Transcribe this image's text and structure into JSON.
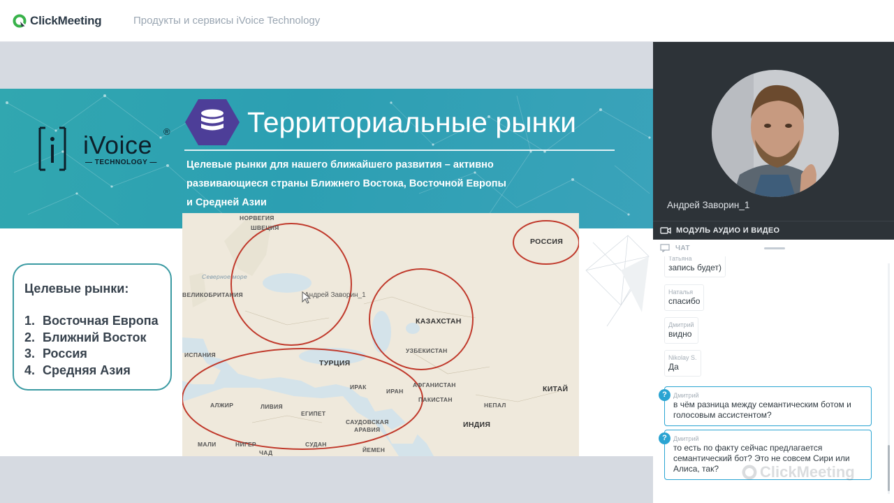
{
  "app": {
    "brand": "ClickMeeting",
    "meeting_title": "Продукты и сервисы iVoice Technology"
  },
  "slide": {
    "company_name": "iVoice",
    "company_reg": "®",
    "company_sub": "— TECHNOLOGY —",
    "title": "Территориальные рынки",
    "subtitle_lines": [
      "Целевые рынки для нашего ближайшего развития – активно",
      "развивающиеся страны Ближнего Востока, Восточной Европы",
      "и Средней Азии"
    ],
    "markets_title": "Целевые рынки:",
    "markets": [
      {
        "num": "1.",
        "label": "Восточная Европа"
      },
      {
        "num": "2.",
        "label": "Ближний Восток"
      },
      {
        "num": "3.",
        "label": "Россия"
      },
      {
        "num": "4.",
        "label": "Средняя Азия"
      }
    ],
    "map": {
      "russia": "РОССИЯ",
      "kazakhstan": "КАЗАХСТАН",
      "uzbekistan": "УЗБЕКИСТАН",
      "norway": "НОРВЕГИЯ",
      "sweden": "ШВЕЦИЯ",
      "sea": "Северное море",
      "britain": "ВЕЛИКОБРИТАНИЯ",
      "spain": "ИСПАНИЯ",
      "turkey": "ТУРЦИЯ",
      "iraq": "ИРАК",
      "iran": "ИРАН",
      "afghanistan": "АФГАНИСТАН",
      "pakistan": "ПАКИСТАН",
      "china": "КИТАЙ",
      "nepal": "НЕПАЛ",
      "india": "ИНДИЯ",
      "algeria": "АЛЖИР",
      "libya": "ЛИВИЯ",
      "egypt": "ЕГИПЕТ",
      "saudi1": "САУДОВСКАЯ",
      "saudi2": "АРАВИЯ",
      "mali": "МАЛИ",
      "niger": "НИГЕР",
      "sudan": "СУДАН",
      "chad": "ЧАД",
      "yemen": "ЙЕМЕН",
      "cursor_user": "Андрей Заворин_1"
    }
  },
  "panel": {
    "presenter": "Андрей Заворин_1",
    "av_label": "МОДУЛЬ АУДИО И ВИДЕО",
    "chat_label": "ЧАТ",
    "messages": [
      {
        "author": "Татьяна",
        "text": "запись будет)"
      },
      {
        "author": "Наталья",
        "text": "спасибо"
      },
      {
        "author": "Дмитрий",
        "text": "видно"
      },
      {
        "author": "Nikolay S.",
        "text": "Да"
      }
    ],
    "questions": [
      {
        "author": "Дмитрий",
        "lines": [
          "в чём разница между семантическим ботом и",
          "голосовым ассистентом?"
        ]
      },
      {
        "author": "Дмитрий",
        "lines": [
          "то есть по факту сейчас предлагается",
          "семантический бот? Это не совсем Сири или",
          "Алиса, так?"
        ]
      }
    ],
    "question_badge": "?",
    "watermark": "ClickMeeting"
  },
  "colors": {
    "accent_green": "#38b24a",
    "slide_teal": "#2fa3b2",
    "hex_purple": "#4d3e98",
    "question_blue": "#2aa4d2",
    "circle_red": "#c0392b"
  },
  "icons": [
    "clickmeeting-logo-icon",
    "database-icon",
    "camera-icon",
    "chat-icon",
    "cursor-icon",
    "question-icon"
  ]
}
